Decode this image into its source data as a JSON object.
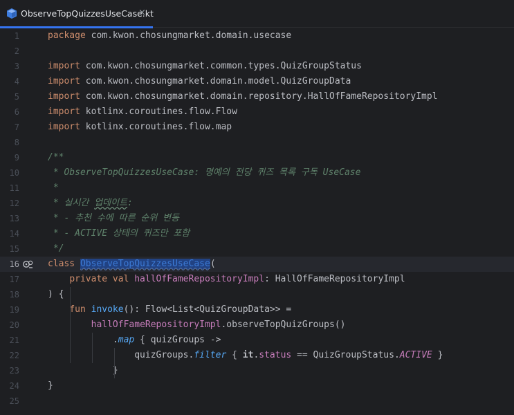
{
  "tab": {
    "title": "ObserveTopQuizzesUseCase.kt",
    "close": "×",
    "icon": "kotlin-file-icon"
  },
  "editor": {
    "current_line": 16,
    "lines": [
      {
        "n": "1",
        "segs": [
          [
            "kw",
            "package"
          ],
          [
            "p",
            " com.kwon.chosungmarket.domain.usecase"
          ]
        ]
      },
      {
        "n": "2",
        "segs": []
      },
      {
        "n": "3",
        "segs": [
          [
            "kw",
            "import"
          ],
          [
            "p",
            " com.kwon.chosungmarket.common.types.QuizGroupStatus"
          ]
        ]
      },
      {
        "n": "4",
        "segs": [
          [
            "kw",
            "import"
          ],
          [
            "p",
            " com.kwon.chosungmarket.domain.model.QuizGroupData"
          ]
        ]
      },
      {
        "n": "5",
        "segs": [
          [
            "kw",
            "import"
          ],
          [
            "p",
            " com.kwon.chosungmarket.domain.repository.HallOfFameRepositoryImpl"
          ]
        ]
      },
      {
        "n": "6",
        "segs": [
          [
            "kw",
            "import"
          ],
          [
            "p",
            " kotlinx.coroutines.flow.Flow"
          ]
        ]
      },
      {
        "n": "7",
        "segs": [
          [
            "kw",
            "import"
          ],
          [
            "p",
            " kotlinx.coroutines.flow.map"
          ]
        ]
      },
      {
        "n": "8",
        "segs": []
      },
      {
        "n": "9",
        "segs": [
          [
            "cmt",
            "/**"
          ]
        ]
      },
      {
        "n": "10",
        "segs": [
          [
            "cmt",
            " * ObserveTopQuizzesUseCase: 명예의 전당 퀴즈 목록 구독 UseCase"
          ]
        ]
      },
      {
        "n": "11",
        "segs": [
          [
            "cmt",
            " *"
          ]
        ]
      },
      {
        "n": "12",
        "segs": [
          [
            "cmt",
            " * 실시간 "
          ],
          [
            "cmtw",
            "업데이트"
          ],
          [
            "cmt",
            ":"
          ]
        ]
      },
      {
        "n": "13",
        "segs": [
          [
            "cmt",
            " * - 추천 수에 따른 순위 변동"
          ]
        ]
      },
      {
        "n": "14",
        "segs": [
          [
            "cmt",
            " * - ACTIVE 상태의 퀴즈만 포함"
          ]
        ]
      },
      {
        "n": "15",
        "segs": [
          [
            "cmt",
            " */"
          ]
        ]
      },
      {
        "n": "16",
        "segs": [
          [
            "kw",
            "class"
          ],
          [
            "p",
            " "
          ],
          [
            "sel",
            "ObserveTopQuizzesUseCase"
          ],
          [
            "p",
            "("
          ]
        ]
      },
      {
        "n": "17",
        "segs": [
          [
            "p",
            "    "
          ],
          [
            "kw",
            "private val"
          ],
          [
            "p",
            " "
          ],
          [
            "prop",
            "hallOfFameRepositoryImpl"
          ],
          [
            "p",
            ": HallOfFameRepositoryImpl"
          ]
        ]
      },
      {
        "n": "18",
        "segs": [
          [
            "p",
            ") {"
          ]
        ]
      },
      {
        "n": "19",
        "segs": [
          [
            "p",
            "    "
          ],
          [
            "kw",
            "fun"
          ],
          [
            "p",
            " "
          ],
          [
            "fn",
            "invoke"
          ],
          [
            "p",
            "(): Flow<List<QuizGroupData>> ="
          ]
        ]
      },
      {
        "n": "20",
        "segs": [
          [
            "p",
            "        "
          ],
          [
            "prop",
            "hallOfFameRepositoryImpl"
          ],
          [
            "p",
            ".observeTopQuizGroups()"
          ]
        ]
      },
      {
        "n": "21",
        "segs": [
          [
            "p",
            "            ."
          ],
          [
            "ext",
            "map"
          ],
          [
            "p",
            " { quizGroups ->"
          ]
        ]
      },
      {
        "n": "22",
        "segs": [
          [
            "p",
            "                quizGroups."
          ],
          [
            "ext",
            "filter"
          ],
          [
            "p",
            " { "
          ],
          [
            "it",
            "it"
          ],
          [
            "p",
            "."
          ],
          [
            "prop",
            "status"
          ],
          [
            "p",
            " == QuizGroupStatus."
          ],
          [
            "const",
            "ACTIVE"
          ],
          [
            "p",
            " }"
          ]
        ]
      },
      {
        "n": "23",
        "segs": [
          [
            "p",
            "            }"
          ]
        ]
      },
      {
        "n": "24",
        "segs": [
          [
            "p",
            "}"
          ]
        ]
      },
      {
        "n": "25",
        "segs": []
      }
    ]
  },
  "gutter": {
    "line16_icon": "run-gutter-icon"
  }
}
